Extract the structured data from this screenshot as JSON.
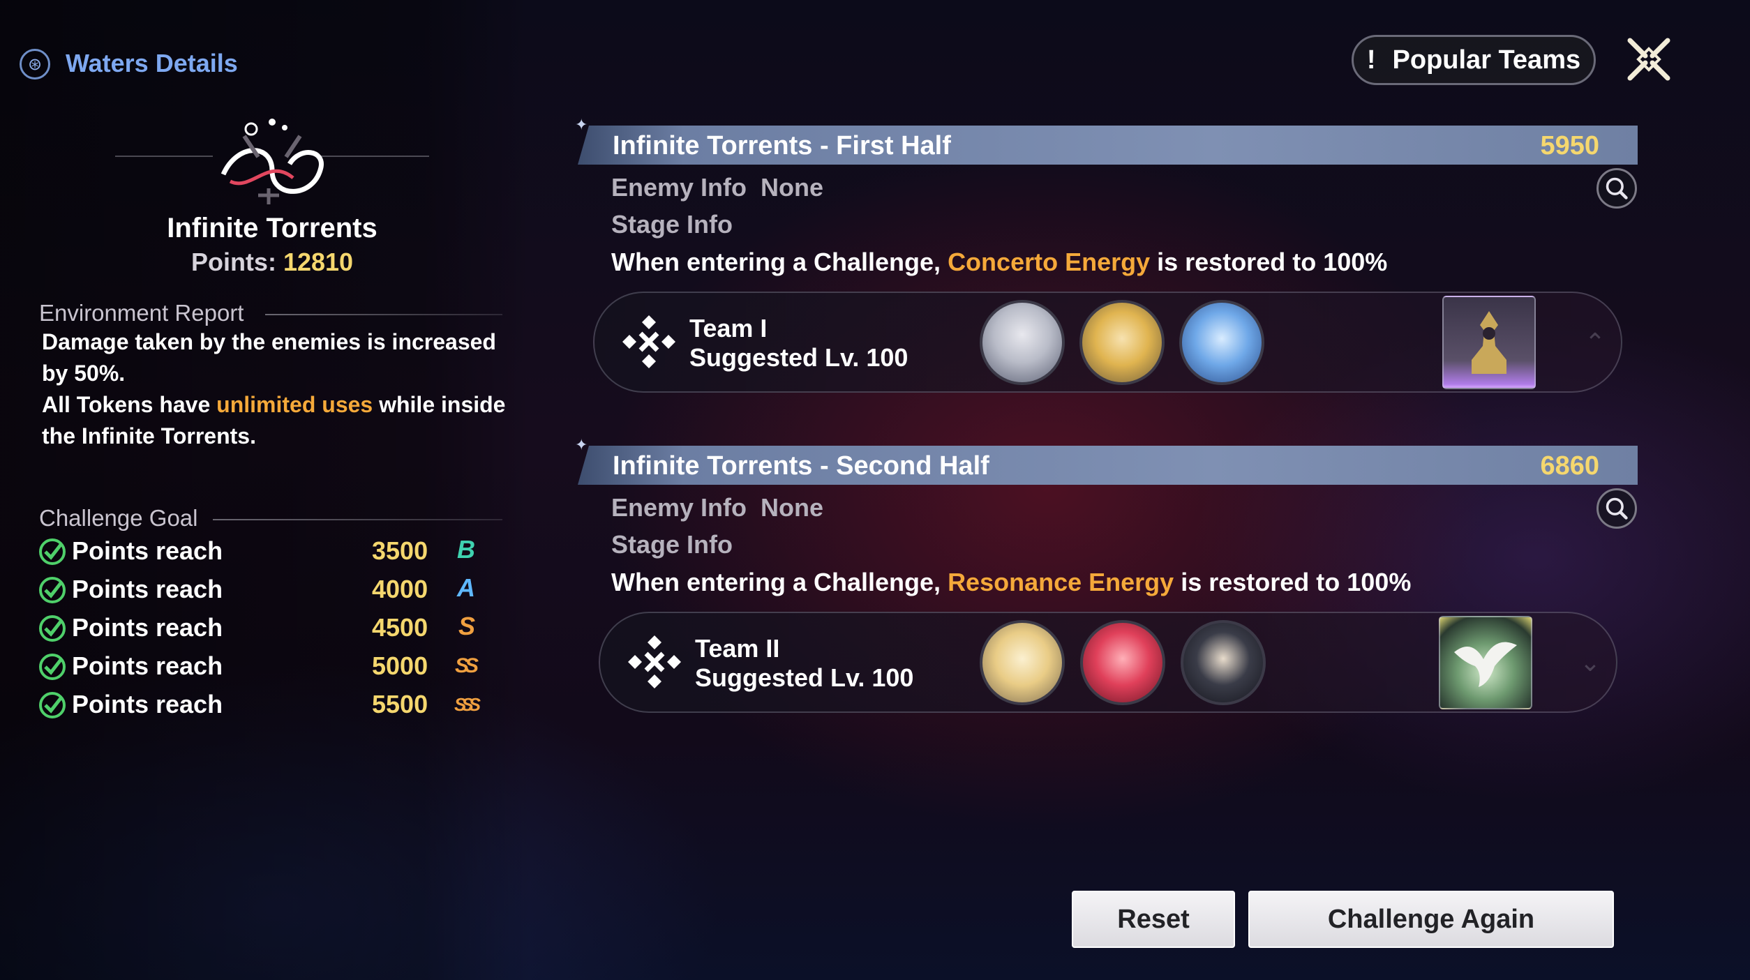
{
  "header": {
    "title": "Waters Details",
    "icon": "spiral-waters-icon"
  },
  "stage": {
    "name": "Infinite Torrents",
    "points_label": "Points:",
    "points_value": "12810"
  },
  "environment": {
    "label": "Environment Report",
    "line1": "Damage taken by the enemies is increased by 50%.",
    "line2_pre": "All Tokens have ",
    "line2_hl": "unlimited uses",
    "line2_post": " while inside the Infinite Torrents."
  },
  "challenge_goal": {
    "label": "Challenge Goal",
    "items": [
      {
        "label": "Points reach",
        "value": "3500",
        "rank": "B",
        "color": "#3fd3b0"
      },
      {
        "label": "Points reach",
        "value": "4000",
        "rank": "A",
        "color": "#5fb8ff"
      },
      {
        "label": "Points reach",
        "value": "4500",
        "rank": "S",
        "color": "#f0a040"
      },
      {
        "label": "Points reach",
        "value": "5000",
        "rank": "SS",
        "color": "#f0a040"
      },
      {
        "label": "Points reach",
        "value": "5500",
        "rank": "SSS",
        "color": "#f0a040"
      }
    ]
  },
  "top_right": {
    "popular_teams": "Popular Teams",
    "bang": "!",
    "close_icon": "close-x-icon"
  },
  "halves": [
    {
      "title": "Infinite Torrents - First Half",
      "score": "5950",
      "enemy_info_label": "Enemy Info",
      "enemy_info_value": "None",
      "stage_info_label": "Stage Info",
      "desc_pre": "When entering a Challenge, ",
      "desc_hl": "Concerto Energy",
      "desc_post": " is restored to 100%",
      "team_name": "Team I",
      "team_lv": "Suggested Lv. 100"
    },
    {
      "title": "Infinite Torrents - Second Half",
      "score": "6860",
      "enemy_info_label": "Enemy Info",
      "enemy_info_value": "None",
      "stage_info_label": "Stage Info",
      "desc_pre": "When entering a Challenge, ",
      "desc_hl": "Resonance Energy",
      "desc_post": " is restored to 100%",
      "team_name": "Team II",
      "team_lv": "Suggested Lv. 100"
    }
  ],
  "buttons": {
    "reset": "Reset",
    "challenge_again": "Challenge Again"
  },
  "colors": {
    "accent_gold": "#f5d76e",
    "highlight_orange": "#f5a93a",
    "header_blue": "#7ea8f0"
  }
}
